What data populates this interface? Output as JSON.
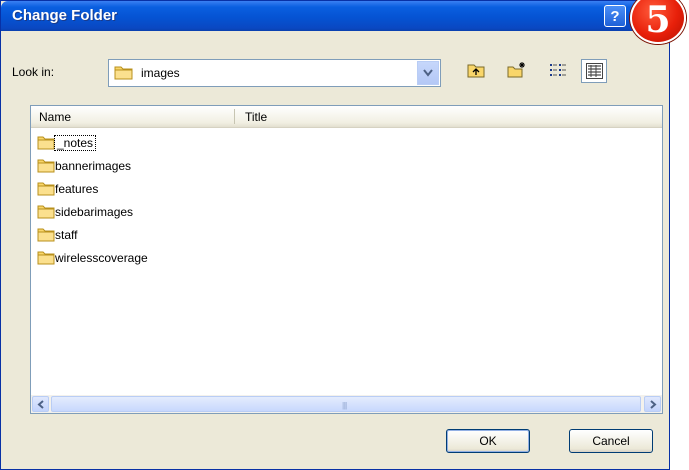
{
  "window": {
    "title": "Change Folder",
    "help_label": "?"
  },
  "badge": {
    "label": "5"
  },
  "lookin": {
    "label": "Look in:",
    "value": "images"
  },
  "toolbar": {
    "icons": [
      "up-folder-icon",
      "new-folder-icon",
      "list-view-icon",
      "details-view-icon"
    ]
  },
  "list": {
    "columns": [
      "Name",
      "Title"
    ],
    "items": [
      "_notes",
      "bannerimages",
      "features",
      "sidebarimages",
      "staff",
      "wirelesscoverage"
    ]
  },
  "buttons": {
    "ok": "OK",
    "cancel": "Cancel"
  },
  "colors": {
    "titlebar": "#0553d3",
    "dialog_bg": "#ece9d8",
    "badge": "#e8200a"
  }
}
